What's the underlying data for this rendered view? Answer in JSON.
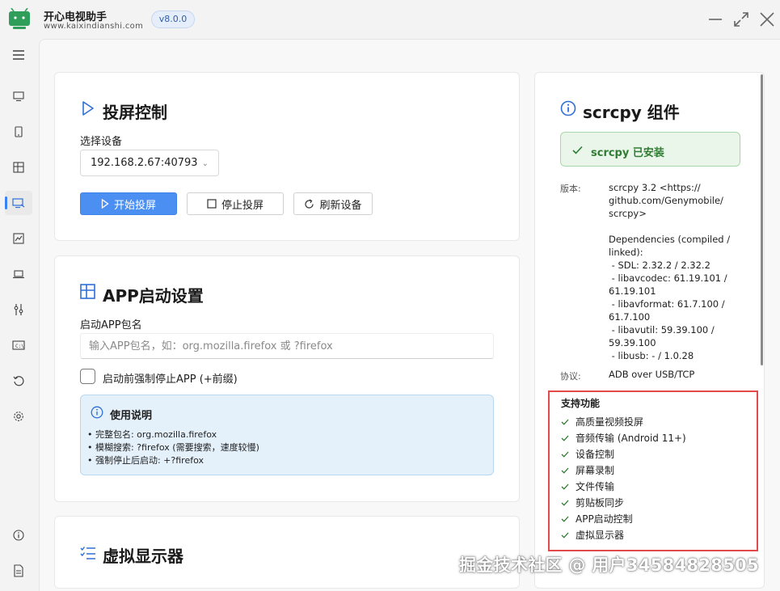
{
  "app": {
    "name": "开心电视助手",
    "url": "www.kaixindianshi.com",
    "version": "v8.0.0"
  },
  "sidebar": {
    "items": [
      {
        "icon": "menu-icon"
      },
      {
        "icon": "monitor-icon"
      },
      {
        "icon": "phone-icon"
      },
      {
        "icon": "layout-icon"
      },
      {
        "icon": "screen-cast-icon",
        "active": true
      },
      {
        "icon": "chart-icon"
      },
      {
        "icon": "laptop-icon"
      },
      {
        "icon": "tools-icon"
      },
      {
        "icon": "terminal-icon"
      },
      {
        "icon": "history-icon"
      },
      {
        "icon": "settings-icon"
      },
      {
        "icon": "info-icon"
      },
      {
        "icon": "document-icon"
      }
    ]
  },
  "screen_control": {
    "title": "投屏控制",
    "device_label": "选择设备",
    "device_value": "192.168.2.67:40793",
    "start_label": "开始投屏",
    "stop_label": "停止投屏",
    "refresh_label": "刷新设备"
  },
  "app_launch": {
    "title": "APP启动设置",
    "package_label": "启动APP包名",
    "package_placeholder": "输入APP包名，如：org.mozilla.firefox 或 ?firefox",
    "force_stop_label": "启动前强制停止APP (+前缀)",
    "usage_title": "使用说明",
    "usage_lines": [
      "• 完整包名: org.mozilla.firefox",
      "• 模糊搜索: ?firefox (需要搜索，速度较慢)",
      "• 强制停止后启动: +?firefox"
    ]
  },
  "virtual_display": {
    "title": "虚拟显示器"
  },
  "scrcpy": {
    "title": "scrcpy 组件",
    "status": "scrcpy 已安装",
    "version_key": "版本:",
    "version_value": "scrcpy 3.2 <https://\ngithub.com/Genymobile/\nscrcpy>\n\nDependencies (compiled /\nlinked):\n - SDL: 2.32.2 / 2.32.2\n - libavcodec: 61.19.101 /\n61.19.101\n - libavformat: 61.7.100 /\n61.7.100\n - libavutil: 59.39.100 /\n59.39.100\n - libusb: - / 1.0.28",
    "protocol_key": "协议:",
    "protocol_value": "ADB over USB/TCP",
    "features_title": "支持功能",
    "features": [
      "高质量视频投屏",
      "音频传输 (Android 11+)",
      "设备控制",
      "屏幕录制",
      "文件传输",
      "剪贴板同步",
      "APP启动控制",
      "虚拟显示器"
    ]
  },
  "watermark": "掘金技术社区 @ 用户34584828505",
  "colors": {
    "accent": "#4b8ff2",
    "success": "#2e7d32",
    "highlight_border": "#e24a4a"
  }
}
